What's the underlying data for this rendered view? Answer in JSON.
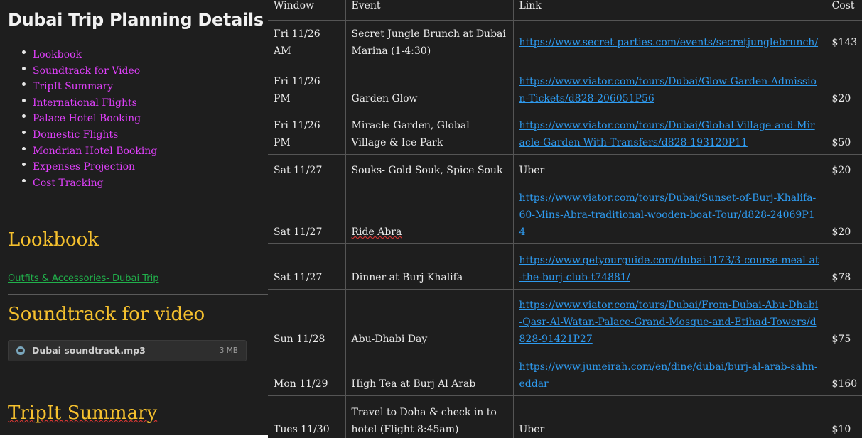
{
  "doc": {
    "title": "Dubai Trip Planning Details",
    "toc": [
      "Lookbook",
      "Soundtrack for Video",
      "TripIt Summary",
      "International Flights",
      "Palace Hotel Booking",
      "Domestic Flights",
      "Mondrian Hotel Booking",
      "Expenses Projection",
      "Cost Tracking"
    ],
    "lookbook_heading": "Lookbook",
    "lookbook_link": "Outfits & Accessories- Dubai Trip",
    "soundtrack_heading": "Soundtrack for video",
    "audio_name": "Dubai soundtrack.mp3",
    "audio_size": "3 MB",
    "tripit_heading": "TripIt Summary"
  },
  "table": {
    "headers": [
      "Window",
      "Event",
      "Link",
      "Cost"
    ],
    "rows": [
      {
        "window": "Fri 11/26 AM",
        "event": "Secret Jungle Brunch at Dubai Marina (1-4:30)",
        "link": "https://www.secret-parties.com/events/secretjunglebrunch/",
        "cost": "$143"
      },
      {
        "window": "Fri 11/26 PM",
        "event": "Garden Glow",
        "link": "https://www.viator.com/tours/Dubai/Glow-Garden-Admission-Tickets/d828-206051P56",
        "cost": "$20"
      },
      {
        "window": "Fri 11/26 PM",
        "event": "Miracle Garden, Global Village & Ice Park",
        "link": "https://www.viator.com/tours/Dubai/Global-Village-and-Miracle-Garden-With-Transfers/d828-193120P11",
        "cost": "$50"
      },
      {
        "window": "Sat 11/27",
        "event": "Souks- Gold Souk, Spice Souk",
        "link": "Uber",
        "cost": "$20"
      },
      {
        "window": "Sat 11/27",
        "event": "Ride Abra",
        "link": "https://www.viator.com/tours/Dubai/Sunset-of-Burj-Khalifa-60-Mins-Abra-traditional-wooden-boat-Tour/d828-24069P14",
        "cost": "$20"
      },
      {
        "window": "Sat 11/27",
        "event": "Dinner at Burj Khalifa",
        "link": "https://www.getyourguide.com/dubai-l173/3-course-meal-at-the-burj-club-t74881/",
        "cost": "$78"
      },
      {
        "window": "Sun 11/28",
        "event": "Abu-Dhabi Day",
        "link": "https://www.viator.com/tours/Dubai/From-Dubai-Abu-Dhabi-Qasr-Al-Watan-Palace-Grand-Mosque-and-Etihad-Towers/d828-91421P27",
        "cost": "$75"
      },
      {
        "window": "Mon 11/29",
        "event": "High Tea at Burj Al Arab",
        "link": "https://www.jumeirah.com/en/dine/dubai/burj-al-arab-sahn-eddar",
        "cost": "$160"
      },
      {
        "window": "Tues 11/30",
        "event": "Travel to Doha & check in to hotel (Flight 8:45am)",
        "link": "Uber",
        "cost": "$10"
      }
    ]
  },
  "colors": {
    "background": "#1e1e1e",
    "heading": "#f6c12e",
    "toc_link": "#e040fb",
    "url": "#2e9bf0",
    "green_link": "#21b04b"
  }
}
